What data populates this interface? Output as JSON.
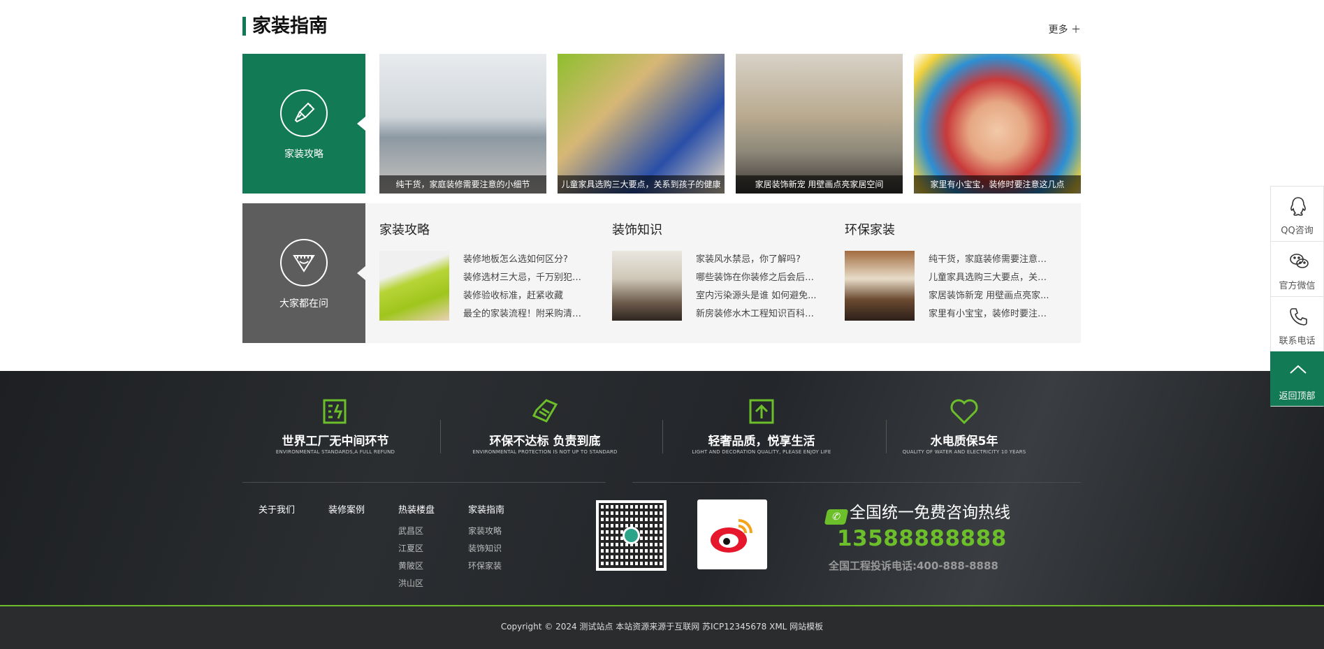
{
  "section": {
    "title": "家装指南",
    "more": "更多 ＋"
  },
  "tiles": {
    "guide_label": "家装攻略",
    "ask_label": "大家都在问"
  },
  "photos": [
    {
      "caption": "纯干货，家庭装修需要注意的小细节"
    },
    {
      "caption": "儿童家具选购三大要点，关系到孩子的健康"
    },
    {
      "caption": "家居装饰新宠 用壁画点亮家居空间"
    },
    {
      "caption": "家里有小宝宝，装修时要注意这几点"
    }
  ],
  "faq": [
    {
      "title": "家装攻略",
      "items": [
        "装修地板怎么选如何区分?",
        "装修选材三大忌，千万别犯了...",
        "装修验收标准，赶紧收藏",
        "最全的家装流程！附采购清单..."
      ]
    },
    {
      "title": "装饰知识",
      "items": [
        "家装风水禁忌，你了解吗?",
        "哪些装饰在你装修之后会后悔...",
        "室内污染源头是谁 如何避免...",
        "新房装修水木工程知识百科全..."
      ]
    },
    {
      "title": "环保家装",
      "items": [
        "纯干货，家庭装修需要注意的...",
        "儿童家具选购三大要点，关系...",
        "家居装饰新宠 用壁画点亮家...",
        "家里有小宝宝，装修时要注意..."
      ]
    }
  ],
  "features": [
    {
      "title": "世界工厂无中间环节",
      "sub": "ENVIRONMENTAL STANDARDS,A FULL REFUND",
      "icon": "factory-icon"
    },
    {
      "title": "环保不达标  负责到底",
      "sub": "ENVIRONMENTAL PROTECTION IS NOT UP TO STANDARD",
      "icon": "tag-icon"
    },
    {
      "title": "轻奢品质，悦享生活",
      "sub": "LIGHT AND DECORATION QUALITY, PLEASE ENJOY LIFE",
      "icon": "upload-box-icon"
    },
    {
      "title": "水电质保5年",
      "sub": "QUALITY OF WATER AND ELECTRICITY 10 YEARS",
      "icon": "heart-icon"
    }
  ],
  "footer_nav": [
    {
      "title": "关于我们",
      "items": []
    },
    {
      "title": "装修案例",
      "items": []
    },
    {
      "title": "热装楼盘",
      "items": [
        "武昌区",
        "江夏区",
        "黄陂区",
        "洪山区"
      ]
    },
    {
      "title": "家装指南",
      "items": [
        "家装攻略",
        "装饰知识",
        "环保家装"
      ]
    }
  ],
  "hotline": {
    "title": "全国统一免费咨询热线",
    "number": "13588888888",
    "sub": "全国工程投诉电话:400-888-8888"
  },
  "copyright": "Copyright © 2024 测试站点 本站资源来源于互联网 苏ICP12345678 XML 网站模板",
  "side_bar": [
    {
      "label": "QQ咨询",
      "icon": "qq-icon"
    },
    {
      "label": "官方微信",
      "icon": "wechat-icon"
    },
    {
      "label": "联系电话",
      "icon": "phone-icon"
    },
    {
      "label": "返回顶部",
      "icon": "arrow-up-icon"
    }
  ],
  "colors": {
    "brand_green": "#137a56",
    "accent_green": "#6cbf2a",
    "tile_gray": "#5d5d5d",
    "footer_dark": "#222427"
  }
}
